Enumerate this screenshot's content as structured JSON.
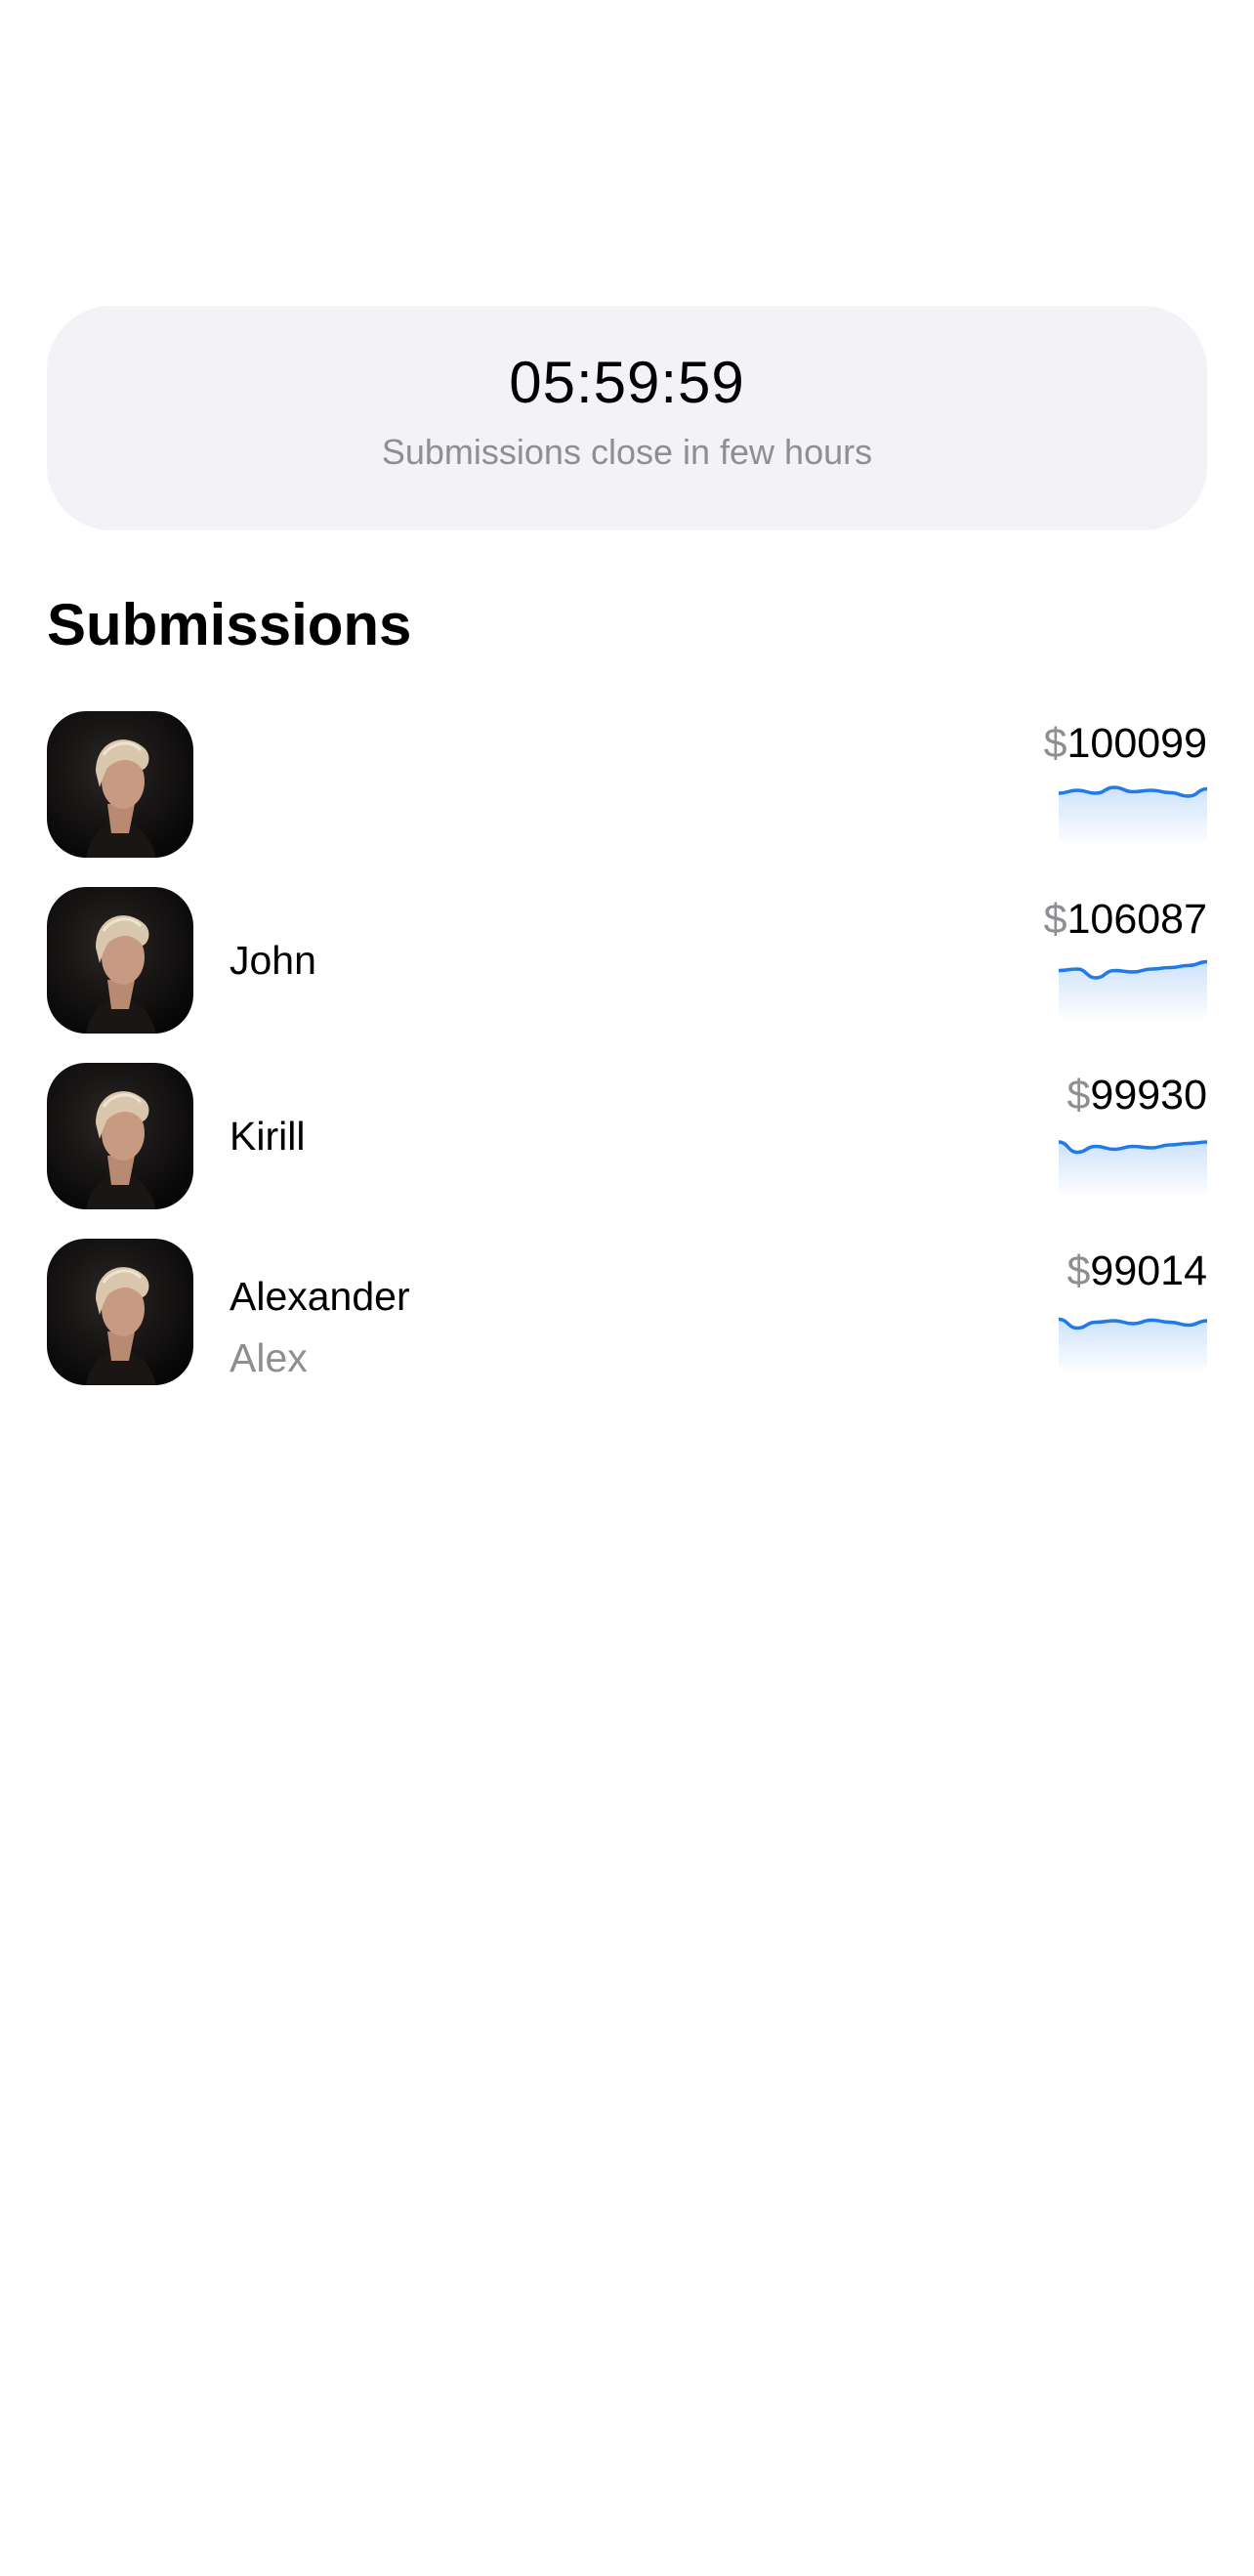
{
  "countdown": {
    "time": "05:59:59",
    "caption": "Submissions close in few hours"
  },
  "section": {
    "title": "Submissions"
  },
  "submissions": [
    {
      "name": "",
      "nickname": "",
      "currency": "$",
      "amount": "100099",
      "trend": [
        0.6,
        0.7,
        0.6,
        0.8,
        0.65,
        0.7,
        0.62,
        0.5,
        0.75
      ]
    },
    {
      "name": "John",
      "nickname": "",
      "currency": "$",
      "amount": "106087",
      "trend": [
        0.55,
        0.6,
        0.3,
        0.55,
        0.5,
        0.6,
        0.65,
        0.72,
        0.85
      ]
    },
    {
      "name": "Kirill",
      "nickname": "",
      "currency": "$",
      "amount": "99930",
      "trend": [
        0.7,
        0.35,
        0.55,
        0.45,
        0.55,
        0.5,
        0.6,
        0.65,
        0.7
      ]
    },
    {
      "name": "Alexander",
      "nickname": "Alex",
      "currency": "$",
      "amount": "99014",
      "trend": [
        0.65,
        0.35,
        0.55,
        0.6,
        0.5,
        0.62,
        0.55,
        0.45,
        0.6
      ]
    }
  ],
  "colors": {
    "accent": "#1f7aea",
    "card_background": "#f2f2f7",
    "secondary_text": "#8e8e93"
  }
}
